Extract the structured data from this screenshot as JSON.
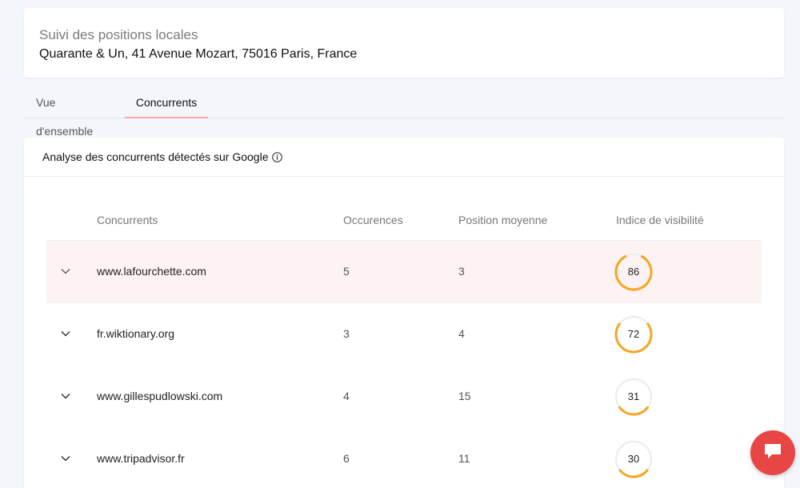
{
  "header": {
    "title": "Suivi des positions locales",
    "address": "Quarante & Un, 41 Avenue Mozart, 75016 Paris, France"
  },
  "tabs": [
    {
      "label": "Vue d'ensemble",
      "active": false
    },
    {
      "label": "Concurrents",
      "active": true
    }
  ],
  "card": {
    "title": "Analyse des concurrents détectés sur Google",
    "icon": "info-icon"
  },
  "table": {
    "columns": [
      "Concurrents",
      "Occurences",
      "Position moyenne",
      "Indice de visibilité"
    ],
    "rows": [
      {
        "name": "www.lafourchette.com",
        "occurrences": "5",
        "position": "3",
        "visibility": 86
      },
      {
        "name": "fr.wiktionary.org",
        "occurrences": "3",
        "position": "4",
        "visibility": 72
      },
      {
        "name": "www.gillespudlowski.com",
        "occurrences": "4",
        "position": "15",
        "visibility": 31
      },
      {
        "name": "www.tripadvisor.fr",
        "occurrences": "6",
        "position": "11",
        "visibility": 30
      }
    ]
  },
  "colors": {
    "gauge": "#f5a623",
    "gauge_track": "#ececec",
    "chat": "#e84545",
    "highlight_row": "#fdf3f2",
    "active_tab_underline": "#f4a7ad"
  },
  "chat": {
    "icon": "chat-bubble-icon"
  }
}
